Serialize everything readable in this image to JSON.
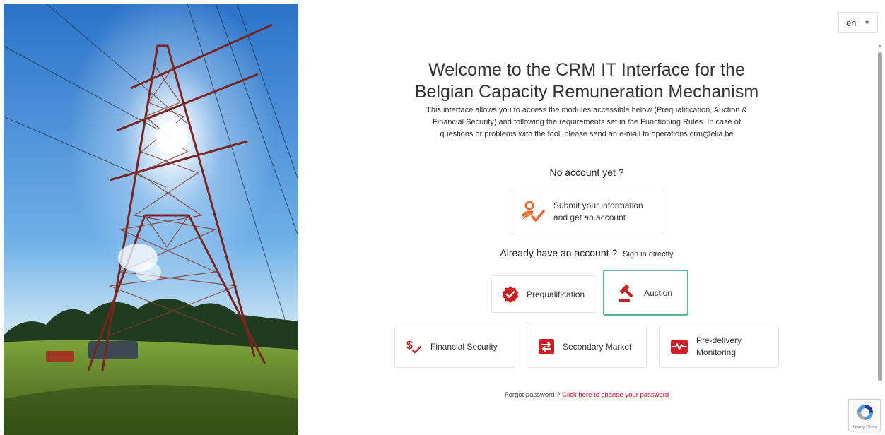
{
  "language": {
    "value": "en"
  },
  "page": {
    "title_line1": "Welcome to the CRM IT Interface for the",
    "title_line2": "Belgian Capacity Remuneration Mechanism",
    "intro_line1": "This interface allows you to access the modules accessible below (Prequalification, Auction &",
    "intro_line2": "Financial Security) and following the requirements set in the Functioning Rules. In case of",
    "intro_line3": "questions or problems with the tool, please send an e-mail to operations.crm@elia.be"
  },
  "no_account": {
    "heading": "No account yet ?",
    "submit_line1": "Submit your information",
    "submit_line2": "and get an account"
  },
  "have_account": {
    "heading": "Already have an account ?",
    "sign_in": "Sign in directly"
  },
  "modules": {
    "prequalification": "Prequalification",
    "auction": "Auction",
    "financial_security": "Financial Security",
    "secondary_market": "Secondary Market",
    "pre_delivery_line1": "Pre-delivery",
    "pre_delivery_line2": "Monitoring"
  },
  "forgot": {
    "text": "Forgot password ?",
    "link": "Click here to change your password"
  },
  "recaptcha": {
    "terms": "Privacy - Terms"
  },
  "colors": {
    "accent_red": "#cc1f24",
    "accent_orange": "#ee6a2a",
    "auction_highlight": "#5ab4a0",
    "link": "#d0021b"
  },
  "icons": {
    "submit": "user-check-icon",
    "prequalification": "badge-check-icon",
    "auction": "gavel-icon",
    "financial_security": "dollar-check-icon",
    "secondary_market": "exchange-arrows-icon",
    "pre_delivery": "pulse-monitor-icon"
  }
}
